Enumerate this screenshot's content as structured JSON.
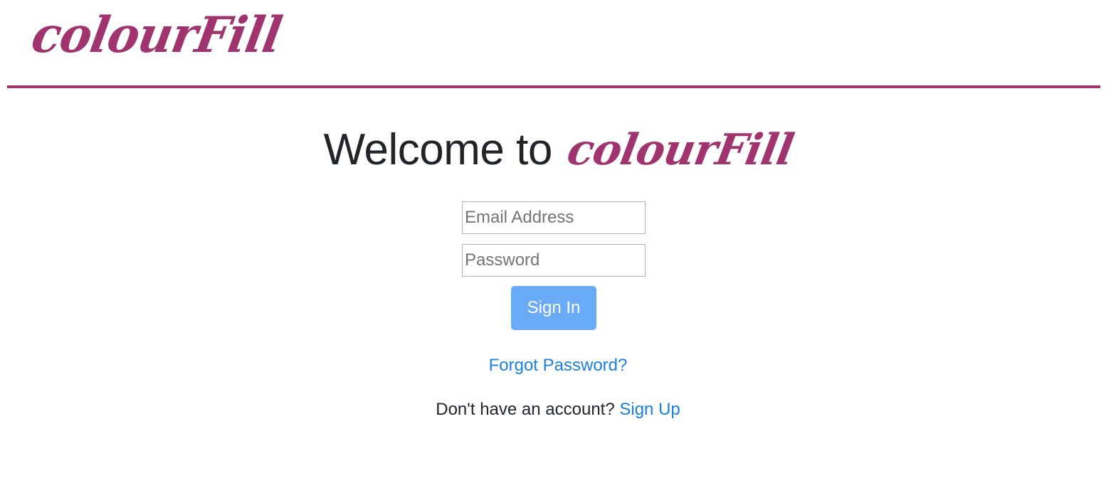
{
  "header": {
    "logo_text": "colourFill"
  },
  "welcome": {
    "prefix": "Welcome to",
    "brand": "colourFill"
  },
  "form": {
    "email": {
      "value": "",
      "placeholder": "Email Address"
    },
    "password": {
      "value": "",
      "placeholder": "Password"
    },
    "signin_label": "Sign In"
  },
  "links": {
    "forgot_password": "Forgot Password?",
    "no_account_text": "Don't have an account?",
    "signup_label": "Sign Up"
  },
  "colors": {
    "brand": "#a0346f",
    "link": "#1a7fe6",
    "button_bg": "#6aabf7",
    "text": "#212529"
  }
}
